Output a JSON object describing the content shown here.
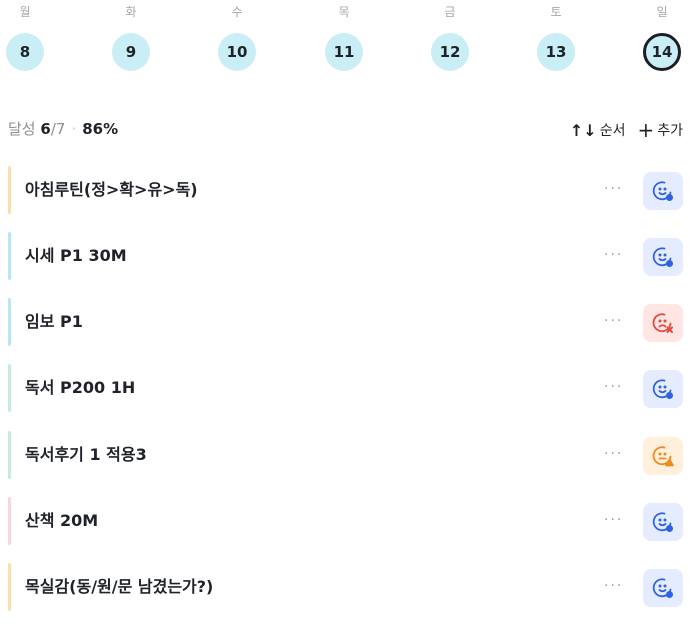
{
  "week": {
    "days": [
      {
        "label": "월",
        "date": "8",
        "selected": false
      },
      {
        "label": "화",
        "date": "9",
        "selected": false
      },
      {
        "label": "수",
        "date": "10",
        "selected": false
      },
      {
        "label": "목",
        "date": "11",
        "selected": false
      },
      {
        "label": "금",
        "date": "12",
        "selected": false
      },
      {
        "label": "토",
        "date": "13",
        "selected": false
      },
      {
        "label": "일",
        "date": "14",
        "selected": true
      }
    ]
  },
  "summary": {
    "label": "달성",
    "done": "6",
    "total": "/7",
    "percent": "86%"
  },
  "toolbar": {
    "order_label": "순서",
    "order_icon": "↑↓",
    "add_label": "추가",
    "add_icon": "+"
  },
  "colors": {
    "day_bg": "#c9eef6",
    "status_done_bg": "#e5ecff",
    "status_done_fg": "#2f63e0",
    "status_fail_bg": "#ffe6e4",
    "status_fail_fg": "#e4493f",
    "status_warn_bg": "#fff0dc",
    "status_warn_fg": "#ee8a22"
  },
  "habits": [
    {
      "title": "아침루틴(정>확>유>독)",
      "color": "#fddfae",
      "status": "done",
      "status_icon": "smile-check-icon",
      "more": "···"
    },
    {
      "title": "시세 P1 30M",
      "color": "#b7e8f0",
      "status": "done",
      "status_icon": "smile-check-icon",
      "more": "···"
    },
    {
      "title": "임보 P1",
      "color": "#b7e8f0",
      "status": "fail",
      "status_icon": "sad-x-icon",
      "more": "···"
    },
    {
      "title": "독서 P200 1H",
      "color": "#c3ecdd",
      "status": "done",
      "status_icon": "smile-check-icon",
      "more": "···"
    },
    {
      "title": "독서후기 1 적용3",
      "color": "#c3ecdd",
      "status": "warn",
      "status_icon": "neutral-warning-icon",
      "more": "···"
    },
    {
      "title": "산책 20M",
      "color": "#fbd3e4",
      "status": "done",
      "status_icon": "smile-check-icon",
      "more": "···"
    },
    {
      "title": "목실감(동/원/문 남겼는가?)",
      "color": "#fddfae",
      "status": "done",
      "status_icon": "smile-check-icon",
      "more": "···"
    }
  ]
}
